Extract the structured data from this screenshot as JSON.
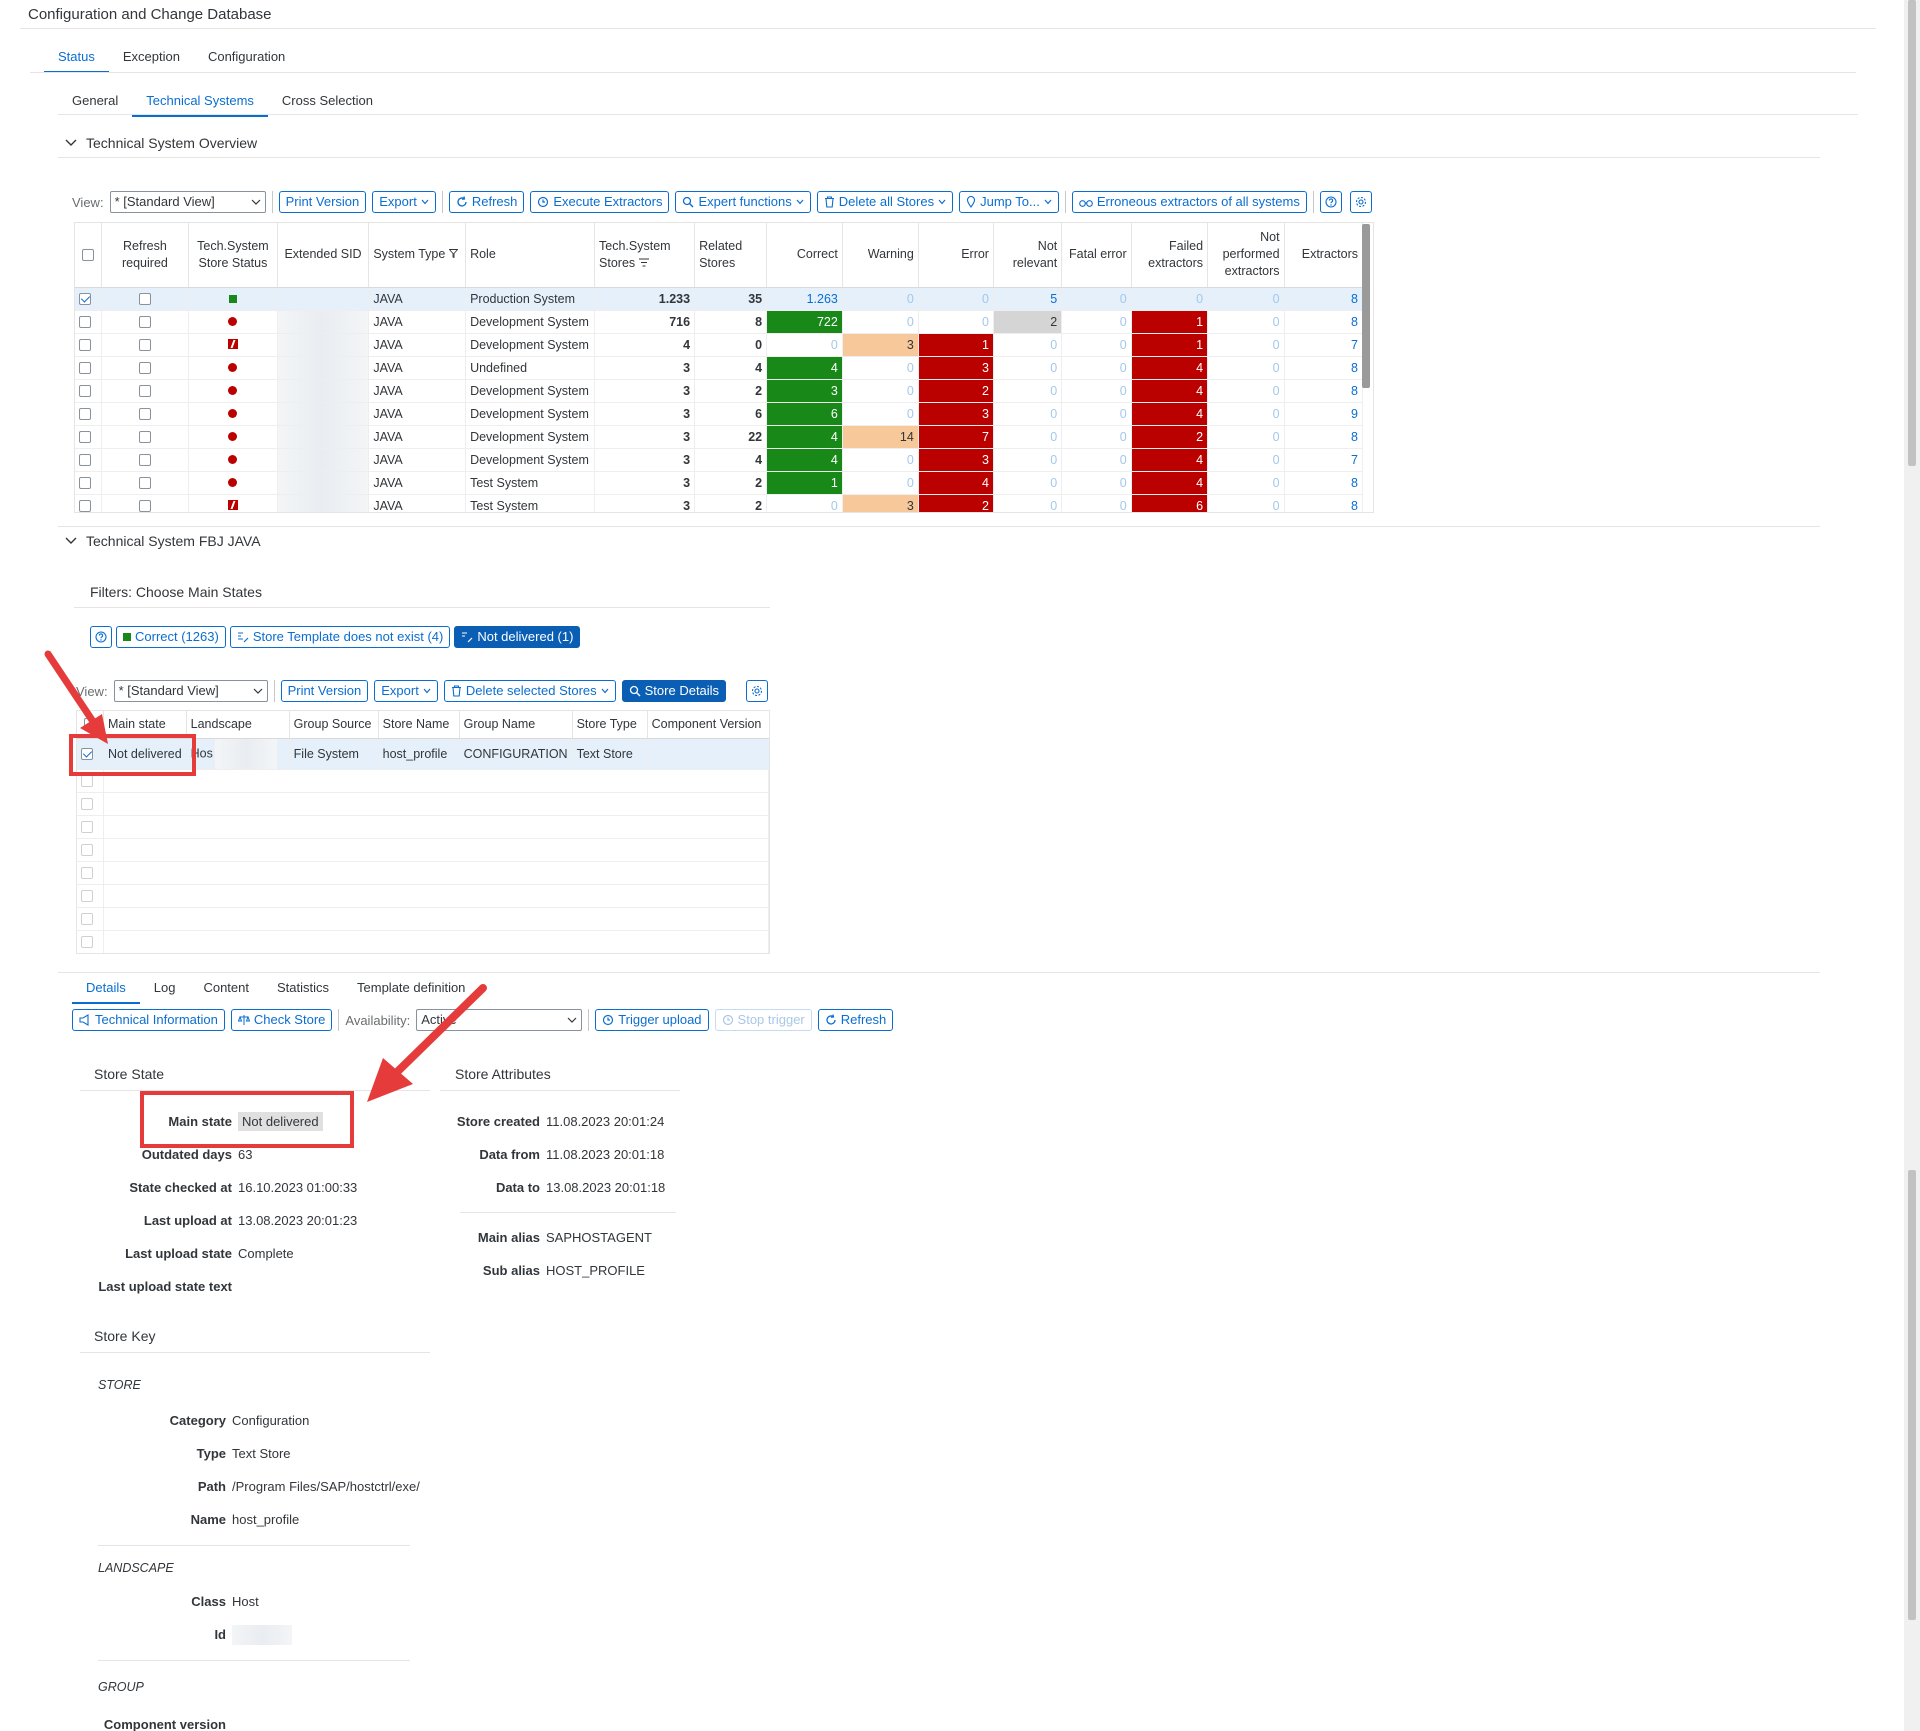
{
  "app": {
    "title": "Configuration and Change Database"
  },
  "main_tabs": [
    "Status",
    "Exception",
    "Configuration"
  ],
  "sub_tabs": [
    "General",
    "Technical Systems",
    "Cross Selection"
  ],
  "overview": {
    "title": "Technical System Overview",
    "view_label": "View:",
    "view_value": "* [Standard View]",
    "buttons": {
      "print": "Print Version",
      "export": "Export",
      "refresh": "Refresh",
      "execute": "Execute Extractors",
      "expert": "Expert functions",
      "delete_all": "Delete all Stores",
      "jump": "Jump To...",
      "erroneous": "Erroneous extractors of all systems"
    },
    "columns": {
      "refresh": "Refresh required",
      "store_status": "Tech.System Store Status",
      "sid": "Extended SID",
      "type": "System Type",
      "role": "Role",
      "stores": "Tech.System Stores",
      "related": "Related Stores",
      "correct": "Correct",
      "warning": "Warning",
      "error": "Error",
      "not_relevant": "Not relevant",
      "fatal": "Fatal error",
      "failed": "Failed extractors",
      "not_performed": "Not performed extractors",
      "extractors": "Extractors"
    },
    "rows": [
      {
        "status": "square",
        "type": "JAVA",
        "role": "Production System",
        "stores": "1.233",
        "related": "35",
        "correct": "1.263",
        "warning": "0",
        "error": "0",
        "not_relevant": "5",
        "fatal": "0",
        "failed": "0",
        "not_performed": "0",
        "extractors": "8"
      },
      {
        "status": "dot",
        "type": "JAVA",
        "role": "Development System",
        "stores": "716",
        "related": "8",
        "correct": "722",
        "warning": "0",
        "error": "0",
        "not_relevant": "2",
        "fatal": "0",
        "failed": "1",
        "not_performed": "0",
        "extractors": "8"
      },
      {
        "status": "flash",
        "type": "JAVA",
        "role": "Development System",
        "stores": "4",
        "related": "0",
        "correct": "0",
        "warning": "3",
        "error": "1",
        "not_relevant": "0",
        "fatal": "0",
        "failed": "1",
        "not_performed": "0",
        "extractors": "7"
      },
      {
        "status": "dot",
        "type": "JAVA",
        "role": "Undefined",
        "stores": "3",
        "related": "4",
        "correct": "4",
        "warning": "0",
        "error": "3",
        "not_relevant": "0",
        "fatal": "0",
        "failed": "4",
        "not_performed": "0",
        "extractors": "8"
      },
      {
        "status": "dot",
        "type": "JAVA",
        "role": "Development System",
        "stores": "3",
        "related": "2",
        "correct": "3",
        "warning": "0",
        "error": "2",
        "not_relevant": "0",
        "fatal": "0",
        "failed": "4",
        "not_performed": "0",
        "extractors": "8"
      },
      {
        "status": "dot",
        "type": "JAVA",
        "role": "Development System",
        "stores": "3",
        "related": "6",
        "correct": "6",
        "warning": "0",
        "error": "3",
        "not_relevant": "0",
        "fatal": "0",
        "failed": "4",
        "not_performed": "0",
        "extractors": "9"
      },
      {
        "status": "dot",
        "type": "JAVA",
        "role": "Development System",
        "stores": "3",
        "related": "22",
        "correct": "4",
        "warning": "14",
        "error": "7",
        "not_relevant": "0",
        "fatal": "0",
        "failed": "2",
        "not_performed": "0",
        "extractors": "8"
      },
      {
        "status": "dot",
        "type": "JAVA",
        "role": "Development System",
        "stores": "3",
        "related": "4",
        "correct": "4",
        "warning": "0",
        "error": "3",
        "not_relevant": "0",
        "fatal": "0",
        "failed": "4",
        "not_performed": "0",
        "extractors": "7"
      },
      {
        "status": "dot",
        "type": "JAVA",
        "role": "Test System",
        "stores": "3",
        "related": "2",
        "correct": "1",
        "warning": "0",
        "error": "4",
        "not_relevant": "0",
        "fatal": "0",
        "failed": "4",
        "not_performed": "0",
        "extractors": "8"
      },
      {
        "status": "flash",
        "type": "JAVA",
        "role": "Test System",
        "stores": "3",
        "related": "2",
        "correct": "0",
        "warning": "3",
        "error": "2",
        "not_relevant": "0",
        "fatal": "0",
        "failed": "6",
        "not_performed": "0",
        "extractors": "8"
      }
    ]
  },
  "fbj": {
    "title": "Technical System FBJ JAVA",
    "filters_title": "Filters: Choose Main States",
    "filters": {
      "correct": "Correct (1263)",
      "template": "Store Template does not exist (4)",
      "not_delivered": "Not delivered (1)"
    },
    "view_label": "View:",
    "view_value": "* [Standard View]",
    "buttons": {
      "print": "Print Version",
      "export": "Export",
      "delete_selected": "Delete selected Stores",
      "details": "Store Details"
    },
    "columns": {
      "main_state": "Main state",
      "landscape": "Landscape",
      "group_source": "Group Source",
      "store_name": "Store Name",
      "group_name": "Group Name",
      "store_type": "Store Type",
      "component_version": "Component Version"
    },
    "row": {
      "main_state": "Not delivered",
      "landscape": "Hos",
      "group_source": "File System",
      "store_name": "host_profile",
      "group_name": "CONFIGURATION",
      "store_type": "Text Store"
    }
  },
  "detail_tabs": [
    "Details",
    "Log",
    "Content",
    "Statistics",
    "Template definition"
  ],
  "detail_toolbar": {
    "tech_info": "Technical Information",
    "check_store": "Check Store",
    "availability_label": "Availability:",
    "availability_value": "Active",
    "trigger": "Trigger upload",
    "stop": "Stop trigger",
    "refresh": "Refresh"
  },
  "store_state": {
    "title": "Store State",
    "main_state_k": "Main state",
    "main_state_v": "Not delivered",
    "outdated_k": "Outdated days",
    "outdated_v": "63",
    "checked_k": "State checked at",
    "checked_v": "16.10.2023 01:00:33",
    "last_upload_k": "Last upload at",
    "last_upload_v": "13.08.2023 20:01:23",
    "upload_state_k": "Last upload state",
    "upload_state_v": "Complete",
    "upload_text_k": "Last upload state text"
  },
  "store_attributes": {
    "title": "Store Attributes",
    "created_k": "Store created",
    "created_v": "11.08.2023 20:01:24",
    "from_k": "Data from",
    "from_v": "11.08.2023 20:01:18",
    "to_k": "Data to",
    "to_v": "13.08.2023 20:01:18",
    "main_alias_k": "Main alias",
    "main_alias_v": "SAPHOSTAGENT",
    "sub_alias_k": "Sub alias",
    "sub_alias_v": "HOST_PROFILE"
  },
  "store_key": {
    "title": "Store Key",
    "store_head": "STORE",
    "category_k": "Category",
    "category_v": "Configuration",
    "type_k": "Type",
    "type_v": "Text Store",
    "path_k": "Path",
    "path_v": "/Program Files/SAP/hostctrl/exe/",
    "name_k": "Name",
    "name_v": "host_profile",
    "landscape_head": "LANDSCAPE",
    "class_k": "Class",
    "class_v": "Host",
    "id_k": "Id",
    "group_head": "GROUP",
    "component_k": "Component version"
  },
  "colors": {
    "accent": "#0a6ed1",
    "correct": "#188918",
    "error": "#bb0000",
    "warning": "#f6c89a",
    "highlight": "#e63b3b"
  }
}
